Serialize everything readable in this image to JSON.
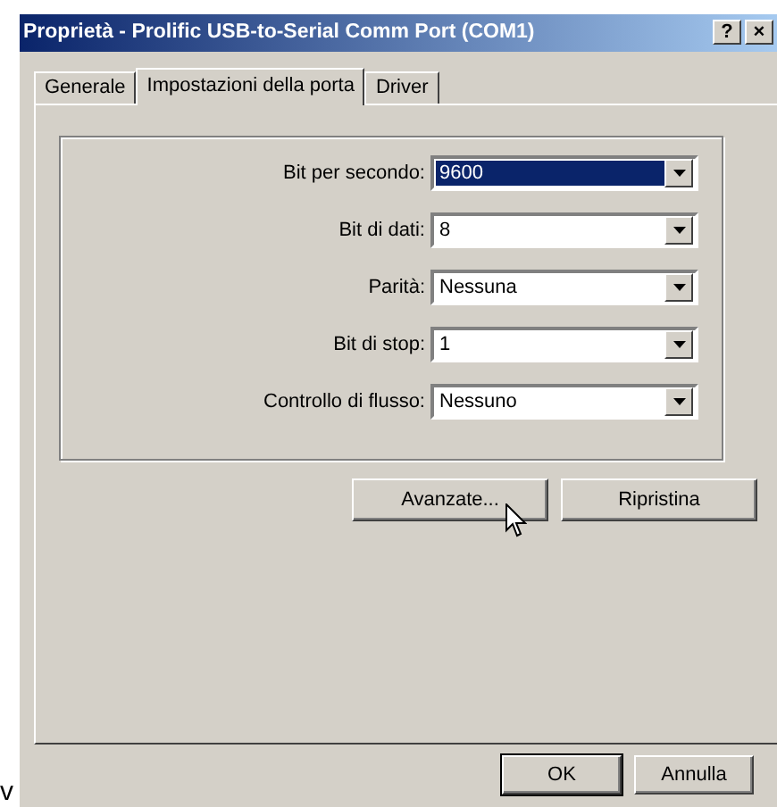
{
  "window": {
    "title": "Proprietà - Prolific USB-to-Serial Comm Port (COM1)",
    "title_buttons": [
      "?",
      "×"
    ]
  },
  "tabs": [
    {
      "label": "Generale",
      "selected": false
    },
    {
      "label": "Impostazioni della porta",
      "selected": true
    },
    {
      "label": "Driver",
      "selected": false
    }
  ],
  "settings": [
    {
      "label": "Bit per secondo:",
      "value": "9600",
      "focused": true
    },
    {
      "label": "Bit di dati:",
      "value": "8",
      "focused": false
    },
    {
      "label": "Parità:",
      "value": "Nessuna",
      "focused": false
    },
    {
      "label": "Bit di stop:",
      "value": "1",
      "focused": false
    },
    {
      "label": "Controllo di flusso:",
      "value": "Nessuno",
      "focused": false
    }
  ],
  "panel_buttons": [
    "Avanzate...",
    "Ripristina"
  ],
  "dialog_buttons": [
    {
      "label": "OK",
      "default": true
    },
    {
      "label": "Annulla",
      "default": false
    }
  ],
  "stray_text": "v"
}
